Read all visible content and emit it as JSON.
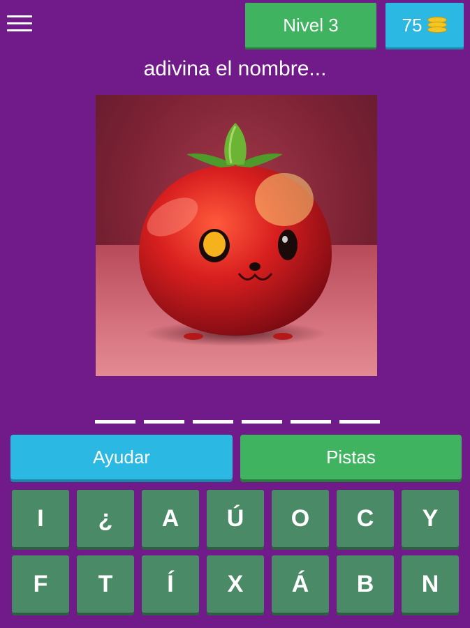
{
  "header": {
    "menu_icon": "hamburger-menu-icon",
    "level_label": "Nivel 3",
    "coins": "75",
    "coins_icon": "coin-stack-icon"
  },
  "prompt": "adivina el nombre...",
  "image": {
    "subject": "cute tomato character",
    "colors": {
      "tomato": "#d81f1f",
      "leaf": "#4e9a2a",
      "background": "#7e2335"
    }
  },
  "answer": {
    "slots": 6
  },
  "actions": {
    "help_label": "Ayudar",
    "hints_label": "Pistas"
  },
  "keyboard": {
    "row1": [
      "I",
      "¿",
      "A",
      "Ú",
      "O",
      "C",
      "Y"
    ],
    "row2": [
      "F",
      "T",
      "Í",
      "X",
      "Á",
      "B",
      "N"
    ]
  },
  "colors": {
    "background": "#711a89",
    "green": "#3fb35f",
    "blue": "#2bb8e3",
    "key": "#4a8a67"
  }
}
